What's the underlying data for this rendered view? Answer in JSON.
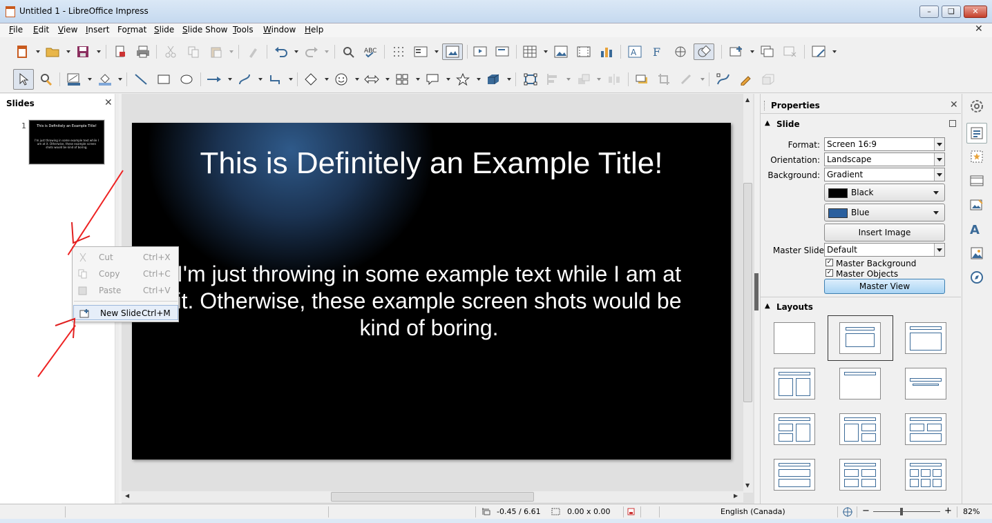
{
  "window": {
    "title": "Untitled 1 - LibreOffice Impress"
  },
  "menubar": {
    "items": [
      {
        "label": "File",
        "u": "F",
        "rest": "ile"
      },
      {
        "label": "Edit",
        "u": "E",
        "rest": "dit"
      },
      {
        "label": "View",
        "u": "V",
        "rest": "iew"
      },
      {
        "label": "Insert",
        "u": "I",
        "rest": "nsert"
      },
      {
        "label": "Format",
        "u": "F",
        "rest": "ormat",
        "pre": ""
      },
      {
        "label": "Slide",
        "u": "S",
        "rest": "lide"
      },
      {
        "label": "Slide Show",
        "u": "S",
        "rest": "lide Show"
      },
      {
        "label": "Tools",
        "u": "T",
        "rest": "ools"
      },
      {
        "label": "Window",
        "u": "W",
        "rest": "indow"
      },
      {
        "label": "Help",
        "u": "H",
        "rest": "elp"
      }
    ]
  },
  "slides_pane": {
    "title": "Slides",
    "slide_number": "1",
    "thumb_title": "This is Definitely an Example Title!",
    "thumb_body": "I'm just throwing in some example text while I am at it. Otherwise, these example screen shots would be kind of boring."
  },
  "context_menu": {
    "items": [
      {
        "label": "Cut",
        "shortcut": "Ctrl+X",
        "enabled": false
      },
      {
        "label": "Copy",
        "shortcut": "Ctrl+C",
        "enabled": false
      },
      {
        "label": "Paste",
        "shortcut": "Ctrl+V",
        "enabled": false
      },
      {
        "label": "New Slide",
        "shortcut": "Ctrl+M",
        "enabled": true
      }
    ]
  },
  "slide": {
    "title": "This is Definitely an Example Title!",
    "body": "I'm just throwing in some example text while I am at it.  Otherwise, these example screen shots would be kind of boring."
  },
  "properties": {
    "title": "Properties",
    "slide_section": "Slide",
    "format_label": "Format:",
    "format_value": "Screen 16:9",
    "orientation_label": "Orientation:",
    "orientation_value": "Landscape",
    "background_label": "Background:",
    "background_value": "Gradient",
    "color1": {
      "label": "Black",
      "hex": "#000000"
    },
    "color2": {
      "label": "Blue",
      "hex": "#2a5f9e"
    },
    "insert_image": "Insert Image",
    "master_slide_label": "Master Slide:",
    "master_slide_value": "Default",
    "master_background": "Master Background",
    "master_objects": "Master Objects",
    "master_view": "Master View",
    "layouts_section": "Layouts"
  },
  "statusbar": {
    "position": "-0.45 / 6.61",
    "size": "0.00 x 0.00",
    "language": "English (Canada)",
    "zoom": "82%"
  },
  "colors": {
    "accent": "#3a6a98",
    "arrow": "#e02020"
  }
}
